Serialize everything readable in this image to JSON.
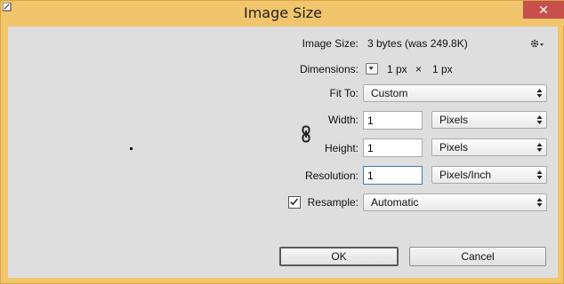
{
  "window": {
    "title": "Image Size",
    "close_label": "✕"
  },
  "info": {
    "image_size_label": "Image Size:",
    "image_size_value": "3 bytes (was 249.8K)",
    "dimensions_label": "Dimensions:",
    "dimensions_width": "1 px",
    "dimensions_times": "×",
    "dimensions_height": "1 px"
  },
  "fit_to": {
    "label": "Fit To:",
    "value": "Custom"
  },
  "width": {
    "label": "Width:",
    "value": "1",
    "unit": "Pixels"
  },
  "height": {
    "label": "Height:",
    "value": "1",
    "unit": "Pixels"
  },
  "resolution": {
    "label": "Resolution:",
    "value": "1",
    "unit": "Pixels/Inch"
  },
  "resample": {
    "label": "Resample:",
    "checked": true,
    "value": "Automatic"
  },
  "buttons": {
    "ok": "OK",
    "cancel": "Cancel"
  }
}
